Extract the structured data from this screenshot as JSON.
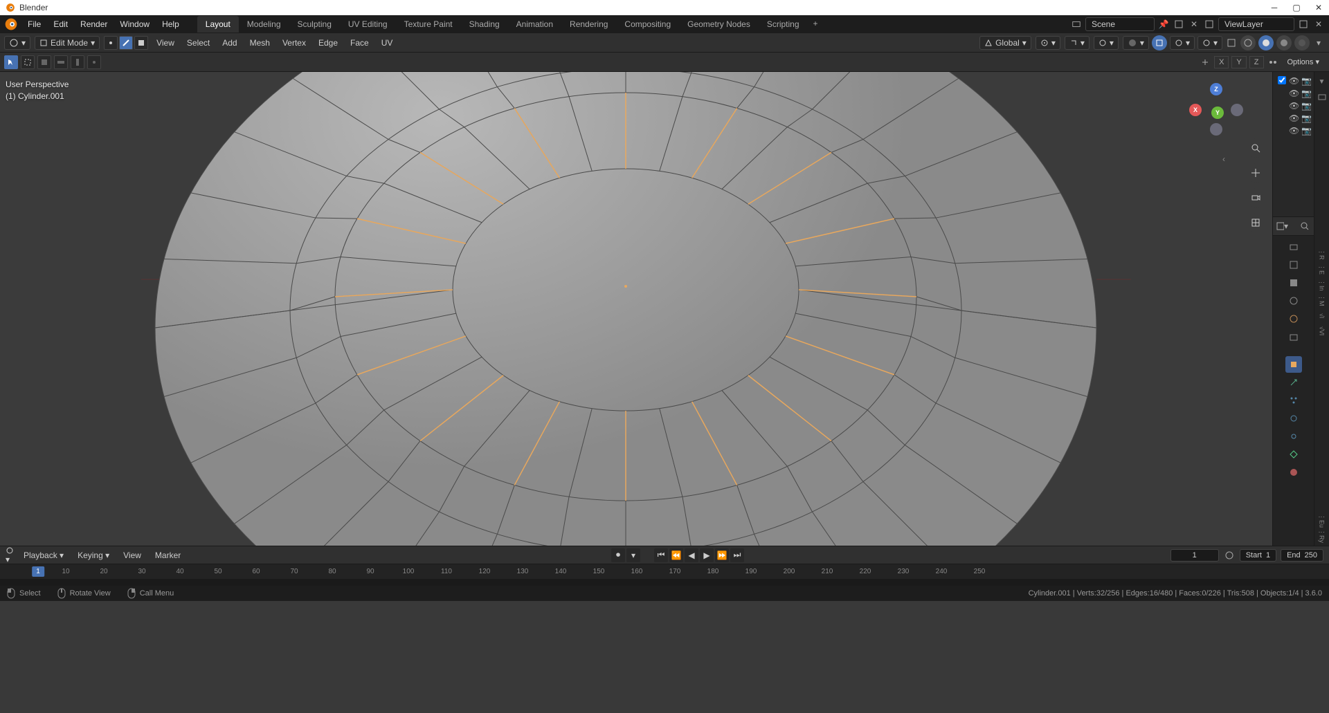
{
  "titlebar": {
    "app": "Blender"
  },
  "topmenu": [
    "File",
    "Edit",
    "Render",
    "Window",
    "Help"
  ],
  "workspaces": [
    "Layout",
    "Modeling",
    "Sculpting",
    "UV Editing",
    "Texture Paint",
    "Shading",
    "Animation",
    "Rendering",
    "Compositing",
    "Geometry Nodes",
    "Scripting"
  ],
  "active_workspace": 0,
  "scene": {
    "label": "Scene",
    "viewlayer": "ViewLayer"
  },
  "vpheader": {
    "mode": "Edit Mode",
    "menus": [
      "View",
      "Select",
      "Add",
      "Mesh",
      "Vertex",
      "Edge",
      "Face",
      "UV"
    ],
    "orientation": "Global"
  },
  "vptools": {
    "axes": [
      "X",
      "Y",
      "Z"
    ],
    "options": "Options"
  },
  "overlay": {
    "persp": "User Perspective",
    "object": "(1) Cylinder.001"
  },
  "gizmo": {
    "x": "X",
    "y": "Y",
    "z": "Z"
  },
  "timeline": {
    "menus": [
      "Playback",
      "Keying",
      "View",
      "Marker"
    ],
    "current": "1",
    "start_label": "Start",
    "start": "1",
    "end_label": "End",
    "end": "250",
    "ticks": [
      "10",
      "20",
      "30",
      "40",
      "50",
      "60",
      "70",
      "80",
      "90",
      "100",
      "110",
      "120",
      "130",
      "140",
      "150",
      "160",
      "170",
      "180",
      "190",
      "200",
      "210",
      "220",
      "230",
      "240",
      "250"
    ]
  },
  "status": {
    "select": "Select",
    "rotate": "Rotate View",
    "call": "Call Menu",
    "stats": "Cylinder.001 | Verts:32/256 | Edges:16/480 | Faces:0/226 | Tris:508 | Objects:1/4 | 3.6.0"
  }
}
